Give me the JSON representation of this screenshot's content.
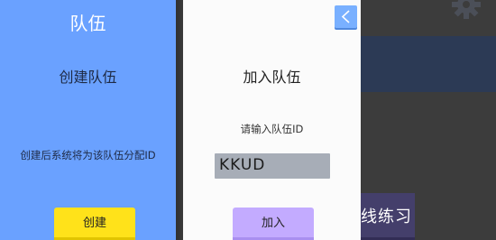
{
  "background": {
    "practice_label": "线练习",
    "gear_icon": "gear-icon"
  },
  "create_panel": {
    "title": "队伍",
    "subtitle": "创建队伍",
    "description": "创建后系统将为该队伍分配ID",
    "button_label": "创建",
    "color": "#6aa1ff",
    "button_color": "#ffe21a"
  },
  "join_panel": {
    "title": "加入队伍",
    "prompt": "请输入队伍ID",
    "input_value": "KKUD",
    "button_label": "加入",
    "back_icon": "chevron-left-icon",
    "button_color": "#c3abff"
  }
}
